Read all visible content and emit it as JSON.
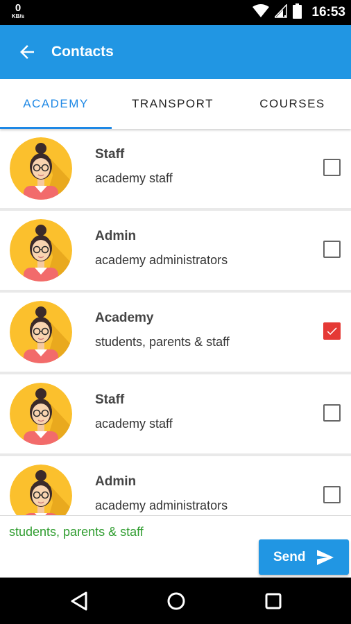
{
  "status_bar": {
    "network_speed_value": "0",
    "network_speed_unit": "KB/s",
    "time": "16:53",
    "icons": [
      "wifi-icon",
      "signal-icon",
      "battery-icon"
    ]
  },
  "app_bar": {
    "title": "Contacts",
    "back_icon": "arrow-left-icon"
  },
  "tabs": [
    {
      "label": "ACADEMY",
      "active": true
    },
    {
      "label": "TRANSPORT",
      "active": false
    },
    {
      "label": "COURSES",
      "active": false
    }
  ],
  "contacts": [
    {
      "title": "Staff",
      "subtitle": "academy staff",
      "checked": false
    },
    {
      "title": "Admin",
      "subtitle": "academy administrators",
      "checked": false
    },
    {
      "title": "Academy",
      "subtitle": "students, parents & staff",
      "checked": true
    },
    {
      "title": "Staff",
      "subtitle": "academy staff",
      "checked": false
    },
    {
      "title": "Admin",
      "subtitle": "academy administrators",
      "checked": false
    }
  ],
  "footer": {
    "selected_recipients": "students, parents & staff",
    "send_label": "Send",
    "send_icon": "send-icon"
  },
  "nav_bar": {
    "icons": [
      "back-triangle-icon",
      "home-circle-icon",
      "recents-square-icon"
    ]
  },
  "colors": {
    "primary": "#2196e3",
    "tab_active": "#1e88e5",
    "checkbox_checked": "#e53935",
    "selected_text": "#2e9c2e",
    "avatar_background": "#fbc02d"
  }
}
